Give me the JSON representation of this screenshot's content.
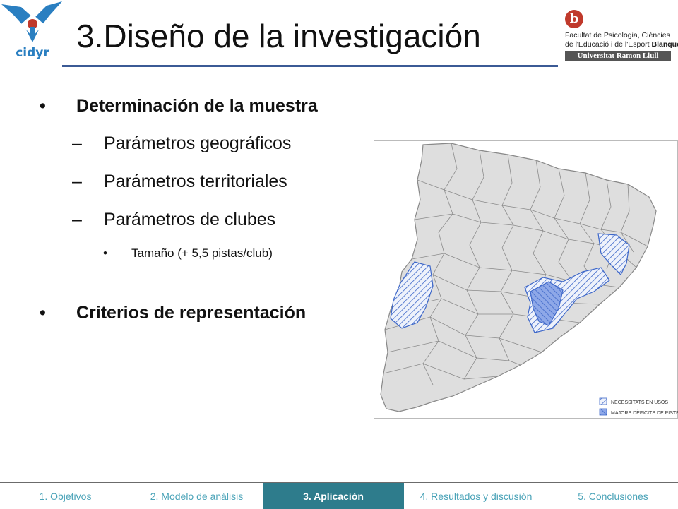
{
  "brand": {
    "cidyr_logo_text": "cidyr",
    "university_logo": {
      "letter": "b",
      "line1": "Facultat de Psicologia, Ciències",
      "line2_prefix": "de l'Educació i de l'Esport",
      "line2_bold": "Blanquerna",
      "bar": "Universitat Ramon Llull"
    }
  },
  "slide": {
    "title": "3.Diseño de la investigación",
    "bullets": [
      {
        "marker": "•",
        "text": "Determinación  de la muestra"
      },
      {
        "marker": "–",
        "text": "Parámetros geográficos"
      },
      {
        "marker": "–",
        "text": "Parámetros territoriales"
      },
      {
        "marker": "–",
        "text": "Parámetros de clubes"
      },
      {
        "marker": "•",
        "text": "Tamaño (+ 5,5 pistas/club)"
      },
      {
        "marker": "•",
        "text": "Criterios de representación"
      }
    ]
  },
  "map": {
    "legend": [
      {
        "label": "NECESSITATS EN USOS"
      },
      {
        "label": "MAJORS DÈFICITS DE PISTES"
      }
    ],
    "colors": {
      "land": "#dedede",
      "border": "#888888",
      "hatch": "#3d67c9",
      "dense": "#7f9de6"
    }
  },
  "nav": {
    "tabs": [
      {
        "label": "1. Objetivos",
        "active": false
      },
      {
        "label": "2. Modelo de análisis",
        "active": false
      },
      {
        "label": "3. Aplicación",
        "active": true
      },
      {
        "label": "4. Resultados y discusión",
        "active": false
      },
      {
        "label": "5. Conclusiones",
        "active": false
      }
    ],
    "active_color": "#2e7c8c",
    "text_color": "#4aa3b8"
  }
}
